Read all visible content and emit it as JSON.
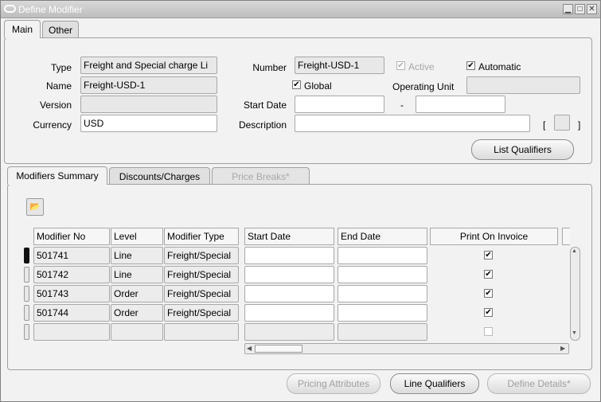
{
  "window": {
    "title": "Define Modifier"
  },
  "top_tabs": [
    {
      "label": "Main"
    },
    {
      "label": "Other"
    }
  ],
  "header": {
    "type_label": "Type",
    "type_value": "Freight and Special charge Li",
    "name_label": "Name",
    "name_value": "Freight-USD-1",
    "version_label": "Version",
    "version_value": "",
    "currency_label": "Currency",
    "currency_value": "USD",
    "number_label": "Number",
    "number_value": "Freight-USD-1",
    "active_label": "Active",
    "automatic_label": "Automatic",
    "global_label": "Global",
    "operating_unit_label": "Operating Unit",
    "operating_unit_value": "",
    "start_date_label": "Start Date",
    "start_date_value": "",
    "date_separator": "-",
    "end_date_value": "",
    "description_label": "Description",
    "description_value": "",
    "bracket_open": "[",
    "bracket_close": "]",
    "list_qualifiers_label": "List Qualifiers"
  },
  "lower_tabs": [
    {
      "label": "Modifiers Summary"
    },
    {
      "label": "Discounts/Charges"
    },
    {
      "label": "Price Breaks*"
    }
  ],
  "grid": {
    "columns": [
      "Modifier No",
      "Level",
      "Modifier Type",
      "Start Date",
      "End Date",
      "Print On Invoice"
    ],
    "rows": [
      {
        "modifier_no": "501741",
        "level": "Line",
        "type": "Freight/Special",
        "start": "",
        "end": "",
        "print": true
      },
      {
        "modifier_no": "501742",
        "level": "Line",
        "type": "Freight/Special",
        "start": "",
        "end": "",
        "print": true
      },
      {
        "modifier_no": "501743",
        "level": "Order",
        "type": "Freight/Special",
        "start": "",
        "end": "",
        "print": true
      },
      {
        "modifier_no": "501744",
        "level": "Order",
        "type": "Freight/Special",
        "start": "",
        "end": "",
        "print": true
      },
      {
        "modifier_no": "",
        "level": "",
        "type": "",
        "start": "",
        "end": "",
        "print": false
      }
    ]
  },
  "footer": {
    "pricing_attributes_label": "Pricing Attributes",
    "line_qualifiers_label": "Line Qualifiers",
    "define_details_label": "Define Details*"
  },
  "icons": {
    "check": "✔",
    "minimize": "▁",
    "maximize": "□",
    "close": "✕",
    "up": "▲",
    "down": "▼",
    "left": "◀",
    "right": "▶",
    "folder": "📂"
  }
}
